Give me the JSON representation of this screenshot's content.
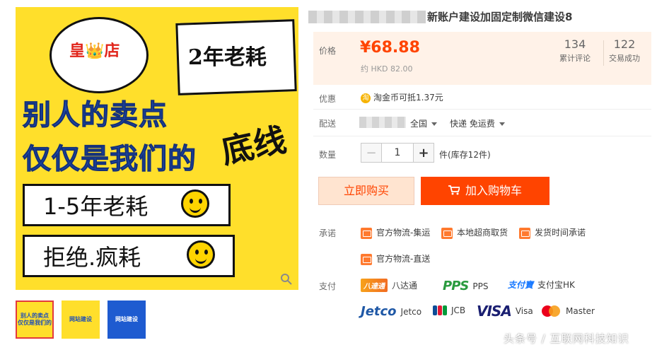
{
  "gallery": {
    "main_image": {
      "shop_badge": "皇👑店",
      "years_bubble": "2年老耗",
      "headline_line1": "别人的卖点",
      "headline_line2": "仅仅是我们的",
      "bottom_line": "底线",
      "banner1": "1-5年老耗",
      "banner2": "拒绝.疯耗"
    },
    "zoom_icon": "magnifier-icon",
    "thumbnails": [
      {
        "label": "别人的卖点 仅仅是我们的",
        "active": true
      },
      {
        "label": "网站建设",
        "active": false
      },
      {
        "label": "网站建设",
        "active": false
      }
    ]
  },
  "product": {
    "title": "新账户建设加固定制微信建设8"
  },
  "price_box": {
    "price_label": "价格",
    "price": "¥68.88",
    "hkd": "约 HKD 82.00",
    "reviews_count": "134",
    "reviews_label": "累计评论",
    "sales_count": "122",
    "sales_label": "交易成功"
  },
  "promo": {
    "label": "优惠",
    "coin_icon": "taojinbi-coin-icon",
    "text": "淘金币可抵1.37元"
  },
  "shipping": {
    "label": "配送",
    "region": "全国",
    "method": "快递 免运费"
  },
  "quantity": {
    "label": "数量",
    "value": "1",
    "stock": "件(库存12件)"
  },
  "buttons": {
    "buy_now": "立即购买",
    "add_cart": "加入购物车"
  },
  "promise": {
    "label": "承诺",
    "items": [
      "官方物流-集运",
      "本地超商取货",
      "发货时间承诺",
      "官方物流-直送"
    ]
  },
  "payment": {
    "label": "支付",
    "methods": [
      "八达通",
      "PPS",
      "支付宝HK",
      "Jetco",
      "JCB",
      "Visa",
      "Master"
    ],
    "logos": {
      "octopus": "八達通",
      "pps": "PPS",
      "alipay": "支付寶",
      "jetco": "Jetco",
      "visa": "VISA",
      "master": "MasterCard"
    }
  },
  "watermark": "头条号 / 互联网科技知识",
  "colors": {
    "accent": "#ff4400",
    "price": "#ff4400",
    "price_bg": "#fff2e8"
  }
}
